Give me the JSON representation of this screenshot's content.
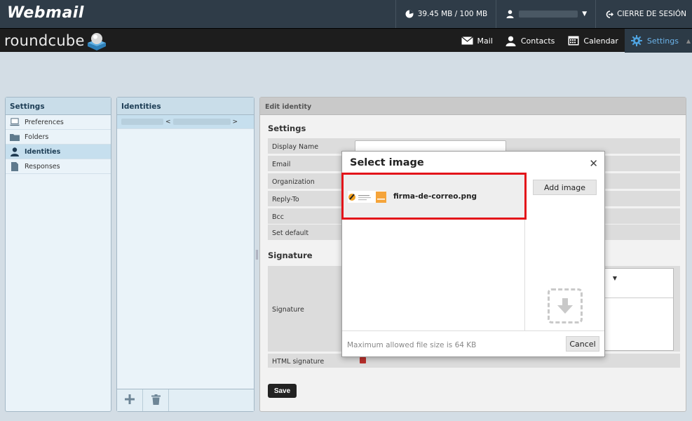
{
  "topbar": {
    "brand": "Webmail",
    "quota": "39.45 MB / 100 MB",
    "logout": "CIERRE DE SESIÓN"
  },
  "header": {
    "logo_text": "roundcube",
    "nav": [
      {
        "label": "Mail",
        "icon": "mail-icon"
      },
      {
        "label": "Contacts",
        "icon": "contacts-icon"
      },
      {
        "label": "Calendar",
        "icon": "calendar-icon"
      },
      {
        "label": "Settings",
        "icon": "gear-icon",
        "active": true
      }
    ]
  },
  "settings_panel": {
    "title": "Settings",
    "items": [
      {
        "label": "Preferences",
        "icon": "computer-icon"
      },
      {
        "label": "Folders",
        "icon": "folder-icon"
      },
      {
        "label": "Identities",
        "icon": "person-icon",
        "selected": true
      },
      {
        "label": "Responses",
        "icon": "document-icon"
      }
    ]
  },
  "identities_panel": {
    "title": "Identities",
    "row_open": "<",
    "row_close": ">"
  },
  "edit_identity": {
    "title": "Edit identity",
    "settings_title": "Settings",
    "fields": [
      "Display Name",
      "Email",
      "Organization",
      "Reply-To",
      "Bcc",
      "Set default"
    ],
    "signature_title": "Signature",
    "signature_label": "Signature",
    "html_signature_label": "HTML signature",
    "save_label": "Save"
  },
  "dialog": {
    "title": "Select image",
    "file_name": "firma-de-correo.png",
    "add_image_label": "Add image",
    "max_size_text": "Maximum allowed file size is 64 KB",
    "cancel_label": "Cancel"
  },
  "colors": {
    "topbar": "#2f3c48",
    "header": "#1d1d1d",
    "accent": "#6bb2e8",
    "highlight": "#e3141a"
  }
}
